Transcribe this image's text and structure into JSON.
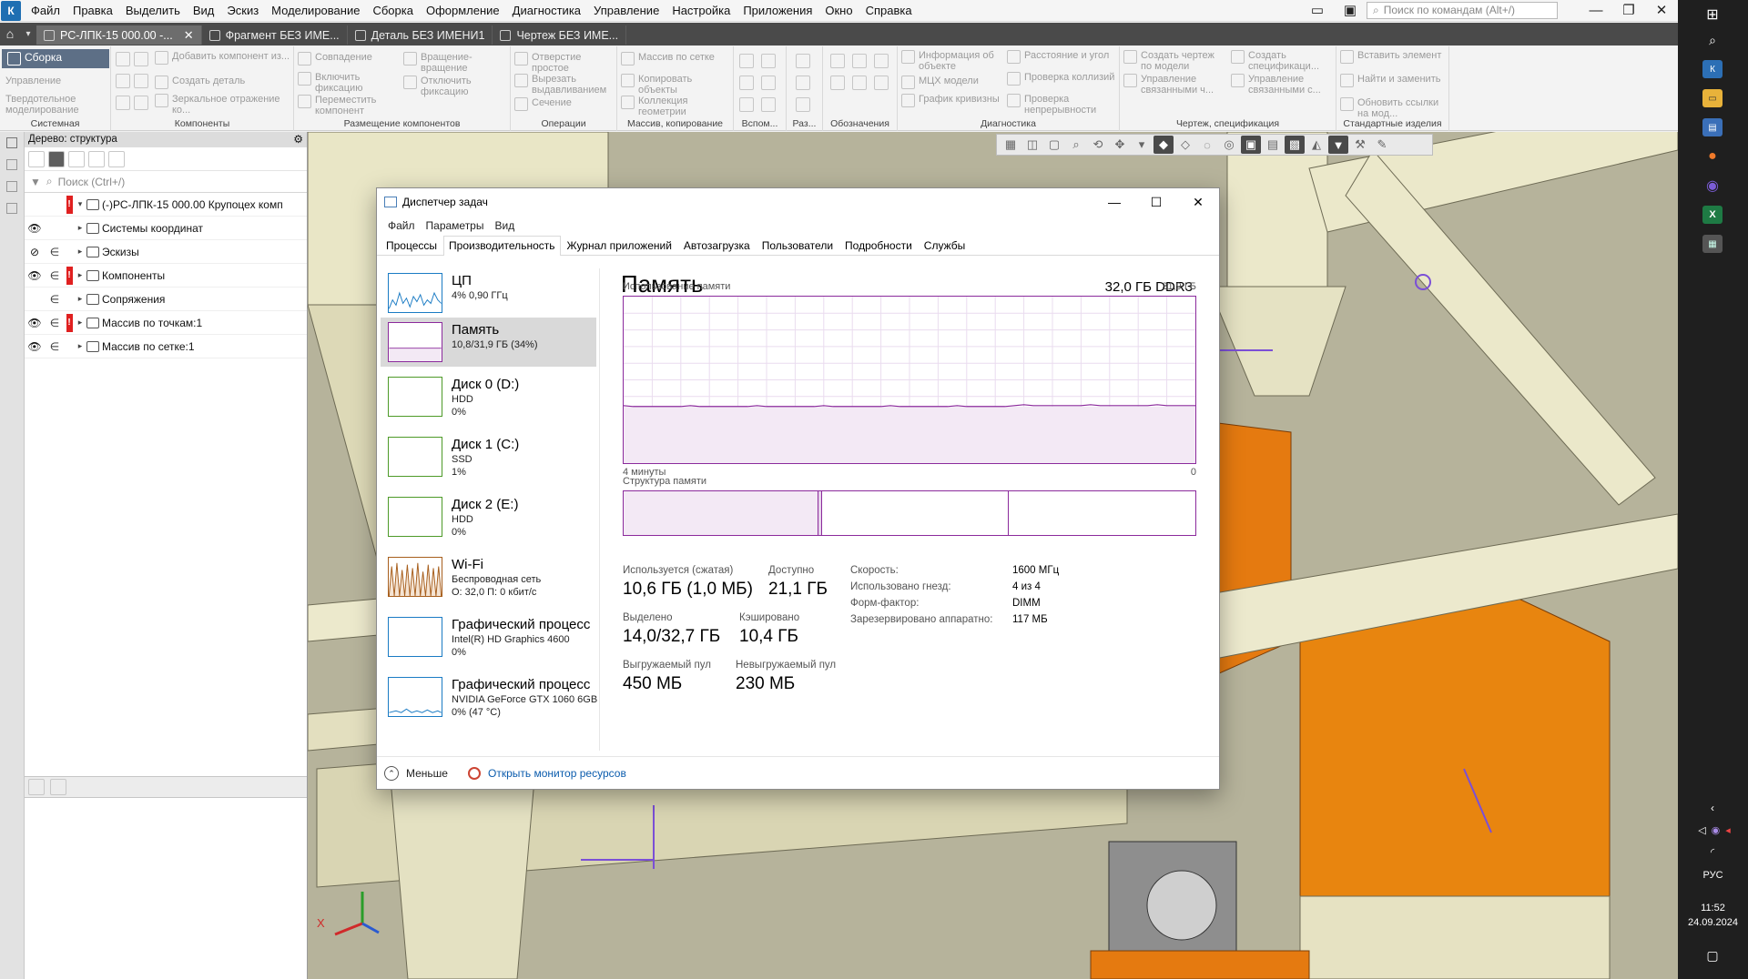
{
  "app": {
    "menu": [
      "Файл",
      "Правка",
      "Выделить",
      "Вид",
      "Эскиз",
      "Моделирование",
      "Сборка",
      "Оформление",
      "Диагностика",
      "Управление",
      "Настройка",
      "Приложения",
      "Окно",
      "Справка"
    ],
    "command_search_placeholder": "Поиск по командам (Alt+/)"
  },
  "doc_tabs": [
    {
      "label": "РС-ЛПК-15 000.00 -...",
      "active": true
    },
    {
      "label": "Фрагмент БЕЗ ИМЕ..."
    },
    {
      "label": "Деталь БЕЗ ИМЕНИ1"
    },
    {
      "label": "Чертеж БЕЗ ИМЕ..."
    }
  ],
  "ribbon": {
    "mode_button": "Сборка",
    "mode_items": [
      "Управление",
      "Твердотельное моделирование"
    ],
    "groups": [
      {
        "title": "Системная",
        "buttons": []
      },
      {
        "title": "Компоненты",
        "buttons": [
          "Добавить компонент из...",
          "Создать деталь",
          "Зеркальное отражение ко..."
        ]
      },
      {
        "title": "Размещение компонентов",
        "buttons": [
          "Совпадение",
          "Включить фиксацию",
          "Переместить компонент",
          "Вращение-вращение",
          "Отключить фиксацию"
        ]
      },
      {
        "title": "Операции",
        "buttons": [
          "Отверстие простое",
          "Вырезать выдавливанием",
          "Сечение"
        ]
      },
      {
        "title": "Массив, копирование",
        "buttons": [
          "Массив по сетке",
          "Копировать объекты",
          "Коллекция геометрии"
        ]
      },
      {
        "title": "Вспом...",
        "buttons": []
      },
      {
        "title": "Раз...",
        "buttons": []
      },
      {
        "title": "Обозначения",
        "buttons": []
      },
      {
        "title": "Диагностика",
        "buttons": [
          "Информация об объекте",
          "МЦХ модели",
          "График кривизны",
          "Расстояние и угол",
          "Проверка коллизий",
          "Проверка непрерывности"
        ]
      },
      {
        "title": "Чертеж, спецификация",
        "buttons": [
          "Создать чертеж по модели",
          "Управление связанными ч...",
          "Создать спецификаци...",
          "Управление связанными с..."
        ]
      },
      {
        "title": "Стандартные изделия",
        "buttons": [
          "Вставить элемент",
          "Найти и заменить",
          "Обновить ссылки на мод..."
        ]
      }
    ]
  },
  "tree": {
    "header": "Дерево: структура",
    "search_placeholder": "Поиск (Ctrl+/)",
    "rows": [
      {
        "label": "(-)РС-ЛПК-15 000.00 Крупоцех комп",
        "eye": "",
        "ref": "",
        "warn": true,
        "arrow": "▾"
      },
      {
        "label": "Системы координат",
        "eye": "👁",
        "ref": "",
        "warn": false,
        "arrow": "▸"
      },
      {
        "label": "Эскизы",
        "eye": "⊘",
        "ref": "∈",
        "warn": false,
        "arrow": "▸"
      },
      {
        "label": "Компоненты",
        "eye": "👁",
        "ref": "∈",
        "warn": true,
        "arrow": "▸"
      },
      {
        "label": "Сопряжения",
        "eye": "",
        "ref": "∈",
        "warn": false,
        "arrow": "▸"
      },
      {
        "label": "Массив по точкам:1",
        "eye": "👁",
        "ref": "∈",
        "warn": true,
        "arrow": "▸"
      },
      {
        "label": "Массив по сетке:1",
        "eye": "👁",
        "ref": "∈",
        "warn": false,
        "arrow": "▸"
      }
    ]
  },
  "viewport": {
    "axis_x": "X",
    "colors": {
      "background": "#b6b39b",
      "machine": "#e9e6c6",
      "orange": "#e57a10",
      "accent": "#7b4fd6"
    }
  },
  "taskmgr": {
    "title": "Диспетчер задач",
    "menu": [
      "Файл",
      "Параметры",
      "Вид"
    ],
    "tabs": [
      "Процессы",
      "Производительность",
      "Журнал приложений",
      "Автозагрузка",
      "Пользователи",
      "Подробности",
      "Службы"
    ],
    "active_tab": 1,
    "side": [
      {
        "name": "ЦП",
        "sub1": "4% 0,90 ГГц",
        "sub2": "",
        "sub3": "",
        "color": "#1a7bc4"
      },
      {
        "name": "Память",
        "sub1": "10,8/31,9 ГБ (34%)",
        "sub2": "",
        "sub3": "",
        "color": "#8b2a9c"
      },
      {
        "name": "Диск 0 (D:)",
        "sub1": "HDD",
        "sub2": "0%",
        "sub3": "",
        "color": "#4d9a28"
      },
      {
        "name": "Диск 1 (C:)",
        "sub1": "SSD",
        "sub2": "1%",
        "sub3": "",
        "color": "#4d9a28"
      },
      {
        "name": "Диск 2 (E:)",
        "sub1": "HDD",
        "sub2": "0%",
        "sub3": "",
        "color": "#4d9a28"
      },
      {
        "name": "Wi-Fi",
        "sub1": "Беспроводная сеть",
        "sub2": "О: 32,0 П: 0 кбит/с",
        "sub3": "",
        "color": "#a75e1c"
      },
      {
        "name": "Графический процесс",
        "sub1": "Intel(R) HD Graphics 4600",
        "sub2": "0%",
        "sub3": "",
        "color": "#1a7bc4"
      },
      {
        "name": "Графический процесс",
        "sub1": "NVIDIA GeForce GTX 1060 6GB",
        "sub2": "0% (47 °C)",
        "sub3": "",
        "color": "#1a7bc4"
      }
    ],
    "memory": {
      "title": "Память",
      "total": "32,0 ГБ DDR3",
      "usage_label": "Использование памяти",
      "usage_max": "31,9 ГБ",
      "time_left": "4 минуты",
      "time_right": "0",
      "usage_fraction": 0.34,
      "structure_label": "Структура памяти",
      "in_use_label": "Используется (сжатая)",
      "in_use": "10,6 ГБ (1,0 МБ)",
      "available_label": "Доступно",
      "available": "21,1 ГБ",
      "committed_label": "Выделено",
      "committed": "14,0/32,7 ГБ",
      "cached_label": "Кэшировано",
      "cached": "10,4 ГБ",
      "paged_label": "Выгружаемый пул",
      "paged": "450 МБ",
      "nonpaged_label": "Невыгружаемый пул",
      "nonpaged": "230 МБ",
      "speed_label": "Скорость:",
      "speed": "1600 МГц",
      "slots_label": "Использовано гнезд:",
      "slots": "4 из 4",
      "form_label": "Форм-фактор:",
      "form": "DIMM",
      "reserved_label": "Зарезервировано аппаратно:",
      "reserved": "117 МБ"
    },
    "footer": {
      "fewer": "Меньше",
      "resmon": "Открыть монитор ресурсов"
    }
  },
  "taskbar": {
    "lang": "РУС",
    "time": "11:52",
    "date": "24.09.2024"
  }
}
